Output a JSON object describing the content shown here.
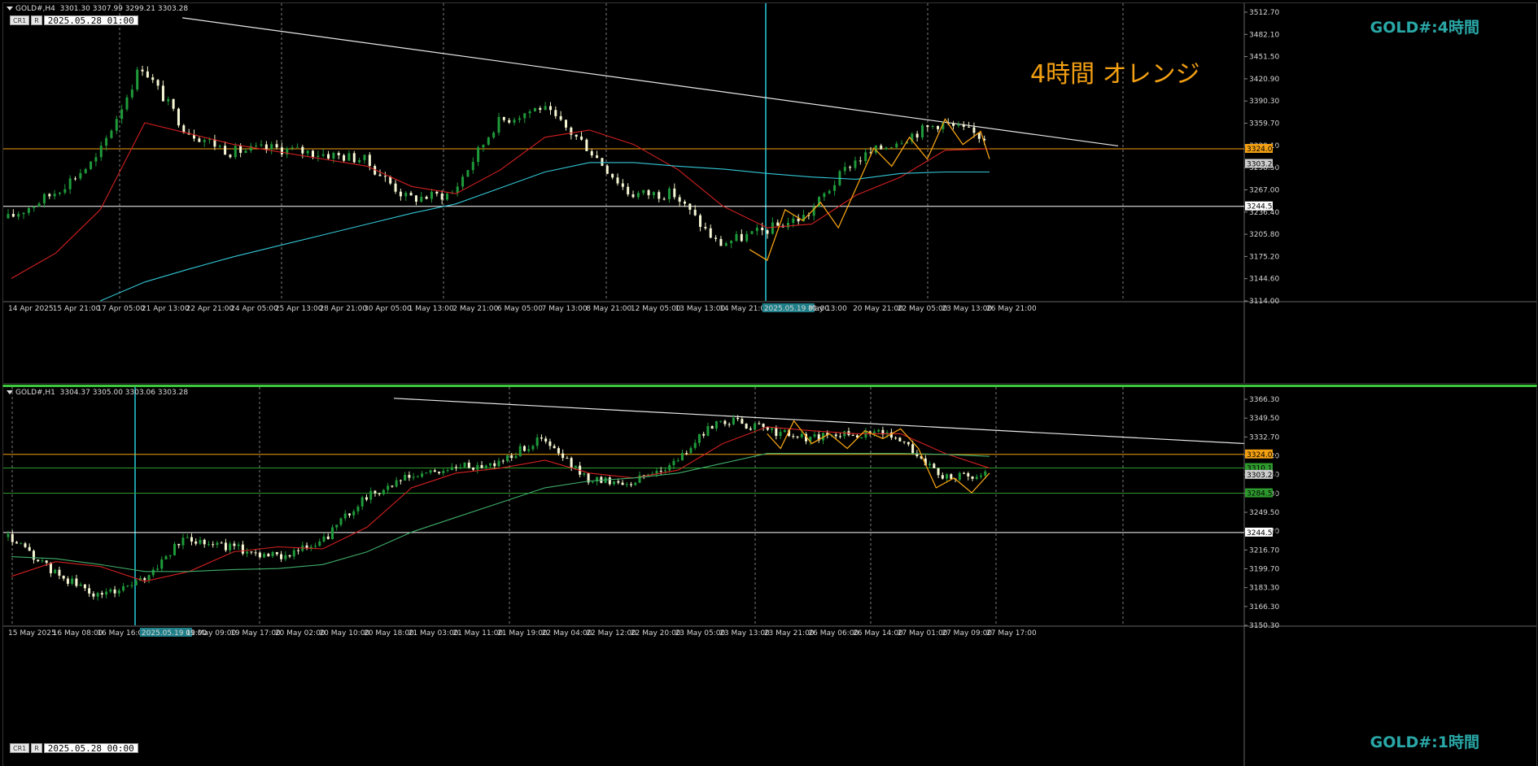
{
  "pane1": {
    "header": "GOLD#,H4  3301.30 3307.99 3299.21 3303.28",
    "cr": "CR1",
    "r": "R",
    "time": "2025.05.28 01:00",
    "title": "GOLD#:4時間",
    "note": "4時間  オレンジ",
    "y_ticks": [
      "3512.70",
      "3482.10",
      "3451.50",
      "3420.90",
      "3390.30",
      "3359.70",
      "3329.10",
      "3298.50",
      "3267.00",
      "3236.40",
      "3205.80",
      "3175.20",
      "3144.60",
      "3114.00"
    ],
    "price_labels": [
      {
        "value": "3324.02",
        "color": "#f3a013"
      },
      {
        "value": "3303.28",
        "color": "#cccccc"
      },
      {
        "value": "3244.58",
        "color": "#ffffff"
      }
    ],
    "x_labels": [
      "14 Apr 2025",
      "15 Apr 21:00",
      "17 Apr 05:00",
      "21 Apr 13:00",
      "22 Apr 21:00",
      "24 Apr 05:00",
      "25 Apr 13:00",
      "28 Apr 21:00",
      "30 Apr 05:00",
      "1 May 13:00",
      "2 May 21:00",
      "6 May 05:00",
      "7 May 13:00",
      "8 May 21:00",
      "12 May 05:00",
      "13 May 13:00",
      "14 May 21:00",
      "2025.05.19 01:00",
      "May 13:00",
      "20 May 21:00",
      "22 May 05:00",
      "23 May 13:00",
      "26 May 21:00"
    ]
  },
  "pane2": {
    "header": "GOLD#,H1  3304.37 3305.00 3303.06 3303.28",
    "cr": "CR1",
    "r": "R",
    "time": "2025.05.28 00:00",
    "title": "GOLD#:1時間",
    "y_ticks": [
      "3366.30",
      "3349.50",
      "3332.70",
      "3316.30",
      "3299.50",
      "3266.30",
      "3249.50",
      "3233.30",
      "3216.70",
      "3199.70",
      "3183.30",
      "3166.30",
      "3150.30"
    ],
    "price_labels": [
      {
        "value": "3324.02",
        "color": "#f3a013"
      },
      {
        "value": "3310.15",
        "color": "#2e9a2e"
      },
      {
        "value": "3303.28",
        "color": "#cccccc"
      },
      {
        "value": "3284.53",
        "color": "#2e9a2e"
      },
      {
        "value": "3244.58",
        "color": "#ffffff"
      }
    ],
    "x_labels": [
      "15 May 2025",
      "16 May 08:00",
      "16 May 16:00",
      "2025.05.19 01:00",
      "19 May 09:00",
      "19 May 17:00",
      "20 May 02:00",
      "20 May 10:00",
      "20 May 18:00",
      "21 May 03:00",
      "21 May 11:00",
      "21 May 19:00",
      "22 May 04:00",
      "22 May 12:00",
      "22 May 20:00",
      "23 May 05:00",
      "23 May 13:00",
      "23 May 21:00",
      "26 May 06:00",
      "26 May 14:00",
      "27 May 01:00",
      "27 May 09:00",
      "27 May 17:00"
    ]
  },
  "chart_data": [
    {
      "type": "line",
      "title": "GOLD#:4時間",
      "ylim": [
        3114.0,
        3512.7
      ],
      "x": [
        "14 Apr 2025",
        "15 Apr 21:00",
        "17 Apr 05:00",
        "21 Apr 13:00",
        "22 Apr 21:00",
        "24 Apr 05:00",
        "25 Apr 13:00",
        "28 Apr 21:00",
        "30 Apr 05:00",
        "1 May 13:00",
        "2 May 21:00",
        "6 May 05:00",
        "7 May 13:00",
        "8 May 21:00",
        "12 May 05:00",
        "13 May 13:00",
        "14 May 21:00",
        "19 May 01:00",
        "19 May 13:00",
        "20 May 21:00",
        "22 May 05:00",
        "23 May 13:00",
        "26 May 21:00"
      ],
      "series": [
        {
          "values": [
            3228,
            3262,
            3310,
            3440,
            3350,
            3320,
            3325,
            3318,
            3310,
            3255,
            3262,
            3360,
            3382,
            3330,
            3262,
            3262,
            3192,
            3210,
            3232,
            3305,
            3335,
            3360,
            3340
          ]
        },
        {
          "values": [
            3145,
            3180,
            3240,
            3360,
            3345,
            3330,
            3320,
            3310,
            3300,
            3272,
            3262,
            3295,
            3340,
            3350,
            3330,
            3295,
            3245,
            3215,
            3220,
            3260,
            3285,
            3322,
            3324
          ]
        },
        {
          "values": [
            null,
            null,
            3114,
            3140,
            3158,
            3175,
            3190,
            3205,
            3220,
            3235,
            3248,
            3270,
            3292,
            3305,
            3305,
            3300,
            3296,
            3290,
            3285,
            3282,
            3290,
            3292,
            3292
          ]
        }
      ],
      "hlines": [
        3324.02,
        3244.58
      ],
      "trendline": [
        [
          0,
          3505
        ],
        [
          22,
          3328
        ]
      ]
    },
    {
      "type": "line",
      "title": "GOLD#:1時間",
      "ylim": [
        3150.3,
        3380.0
      ],
      "x": [
        "15 May 2025",
        "16 May 08:00",
        "16 May 16:00",
        "19 May 01:00",
        "19 May 09:00",
        "19 May 17:00",
        "20 May 02:00",
        "20 May 10:00",
        "20 May 18:00",
        "21 May 03:00",
        "21 May 11:00",
        "21 May 19:00",
        "22 May 04:00",
        "22 May 12:00",
        "22 May 20:00",
        "23 May 05:00",
        "23 May 13:00",
        "23 May 21:00",
        "26 May 06:00",
        "26 May 14:00",
        "27 May 01:00",
        "27 May 09:00",
        "27 May 17:00"
      ],
      "series": [
        {
          "values": [
            3240,
            3205,
            3180,
            3195,
            3240,
            3230,
            3220,
            3232,
            3280,
            3300,
            3310,
            3315,
            3340,
            3300,
            3295,
            3315,
            3360,
            3350,
            3340,
            3345,
            3345,
            3300,
            3303
          ]
        },
        {
          "values": [
            3200,
            3215,
            3210,
            3195,
            3205,
            3225,
            3230,
            3228,
            3250,
            3290,
            3305,
            3310,
            3318,
            3305,
            3300,
            3308,
            3335,
            3352,
            3348,
            3345,
            3345,
            3325,
            3310
          ]
        },
        {
          "values": [
            3220,
            3218,
            3212,
            3205,
            3205,
            3207,
            3208,
            3212,
            3225,
            3245,
            3260,
            3275,
            3290,
            3297,
            3300,
            3305,
            3315,
            3325,
            3325,
            3325,
            3325,
            3324,
            3322
          ]
        }
      ],
      "hlines": [
        3324.02,
        3310.15,
        3284.53,
        3244.58
      ],
      "trendline": [
        [
          0,
          3381
        ],
        [
          22,
          3335
        ]
      ]
    }
  ]
}
